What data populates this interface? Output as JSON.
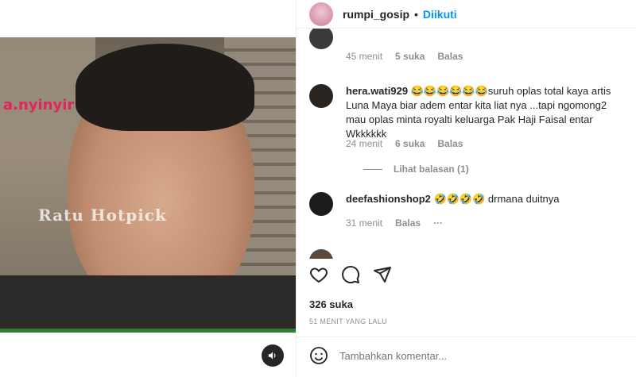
{
  "post": {
    "overlay_text": "a.nyinyir",
    "watermark": "Ratu Hotpick"
  },
  "header": {
    "username": "rumpi_gosip",
    "separator": "•",
    "follow_status": "Diikuti"
  },
  "comments": [
    {
      "meta_time": "45 menit",
      "meta_likes": "5 suka",
      "meta_reply": "Balas"
    },
    {
      "username": "hera.wati929",
      "text": "😂😂😂😂😂😂suruh oplas total kaya artis Luna Maya biar adem entar kita liat nya ...tapi ngomong2 mau oplas minta royalti keluarga Pak Haji Faisal entar Wkkkkkk",
      "meta_time": "24 menit",
      "meta_likes": "6 suka",
      "meta_reply": "Balas",
      "view_replies": "Lihat balasan (1)"
    },
    {
      "username": "deefashionshop2",
      "text": "🤣🤣🤣🤣 drmana duitnya",
      "meta_time": "31 menit",
      "meta_reply": "Balas",
      "more": "···"
    }
  ],
  "likes_count": "326 suka",
  "posted_time": "51 MENIT YANG LALU",
  "add_comment": {
    "placeholder": "Tambahkan komentar..."
  },
  "icons": {
    "heart": "heart-icon",
    "comment": "comment-icon",
    "share": "share-icon",
    "emoji": "emoji-icon",
    "mute": "speaker-icon"
  },
  "colors": {
    "accent": "#0095f6",
    "text": "#262626",
    "muted": "#8e8e8e"
  }
}
